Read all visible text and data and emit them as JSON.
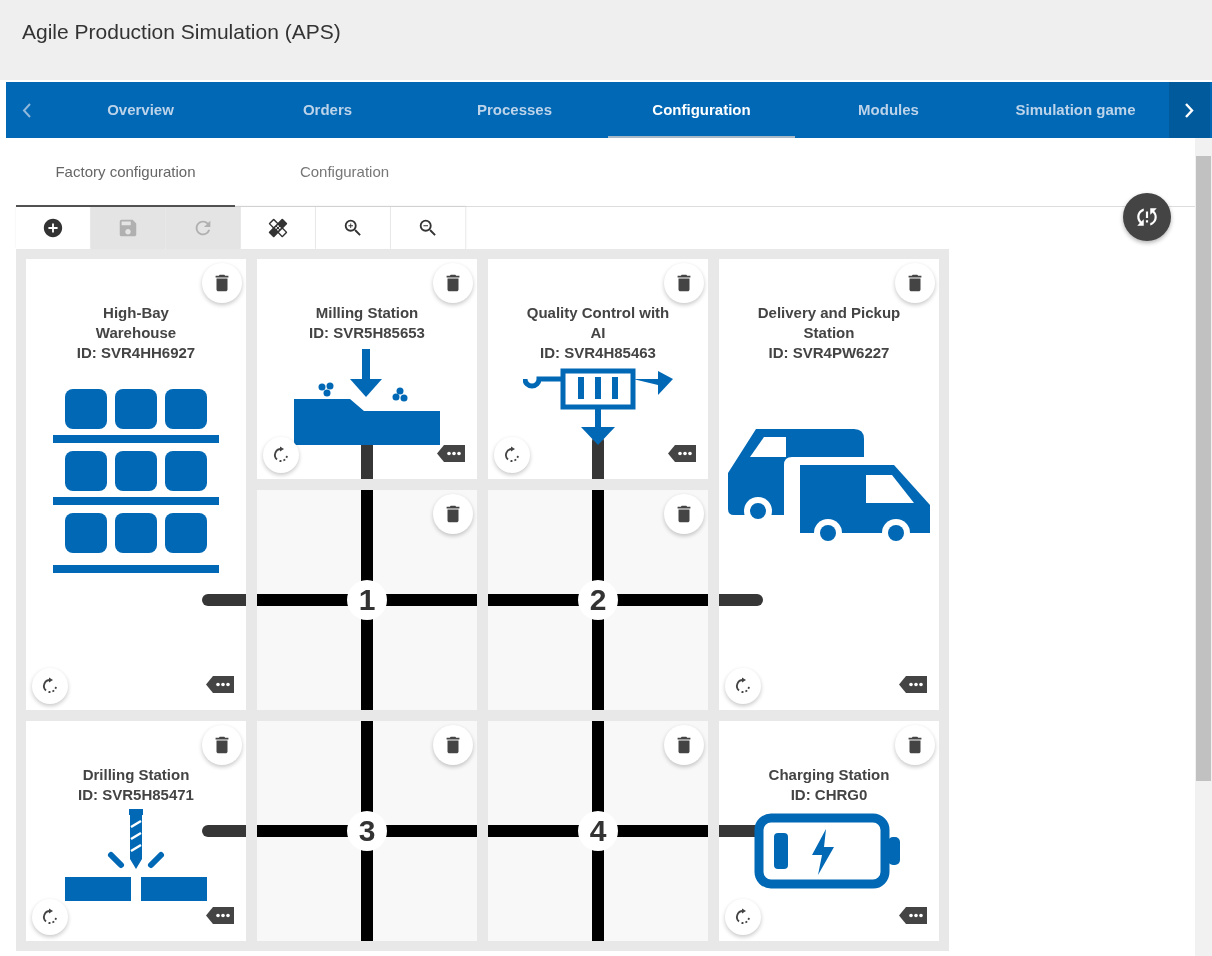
{
  "header": {
    "title": "Agile Production Simulation (APS)"
  },
  "tabs": [
    {
      "label": "Overview",
      "selected": false
    },
    {
      "label": "Orders",
      "selected": false
    },
    {
      "label": "Processes",
      "selected": false
    },
    {
      "label": "Configuration",
      "selected": true
    },
    {
      "label": "Modules",
      "selected": false
    },
    {
      "label": "Simulation game",
      "selected": false
    }
  ],
  "subtabs": [
    {
      "label": "Factory configuration",
      "selected": true
    },
    {
      "label": "Configuration",
      "selected": false
    }
  ],
  "toolbar": [
    {
      "kind": "add",
      "disabled": false
    },
    {
      "kind": "save",
      "disabled": true
    },
    {
      "kind": "redo",
      "disabled": true
    },
    {
      "kind": "repair",
      "disabled": false
    },
    {
      "kind": "zoomin",
      "disabled": false
    },
    {
      "kind": "zoomout",
      "disabled": false
    }
  ],
  "cells": [
    {
      "kind": "warehouse",
      "title": "High-Bay Warehouse",
      "id": "ID: SVR4HH6927"
    },
    {
      "kind": "mill",
      "title": "Milling Station",
      "id": "ID: SVR5H85653"
    },
    {
      "kind": "quality",
      "title": "Quality Control with AI",
      "id": "ID: SVR4H85463"
    },
    {
      "kind": "delivery",
      "title": "Delivery and Pickup Station",
      "id": "ID: SVR4PW6227"
    },
    {
      "kind": "intersection",
      "number": "1"
    },
    {
      "kind": "intersection",
      "number": "2"
    },
    {
      "kind": "drill",
      "title": "Drilling Station",
      "id": "ID: SVR5H85471"
    },
    {
      "kind": "intersection",
      "number": "3"
    },
    {
      "kind": "intersection",
      "number": "4"
    },
    {
      "kind": "charging",
      "title": "Charging Station",
      "id": "ID: CHRG0"
    }
  ]
}
